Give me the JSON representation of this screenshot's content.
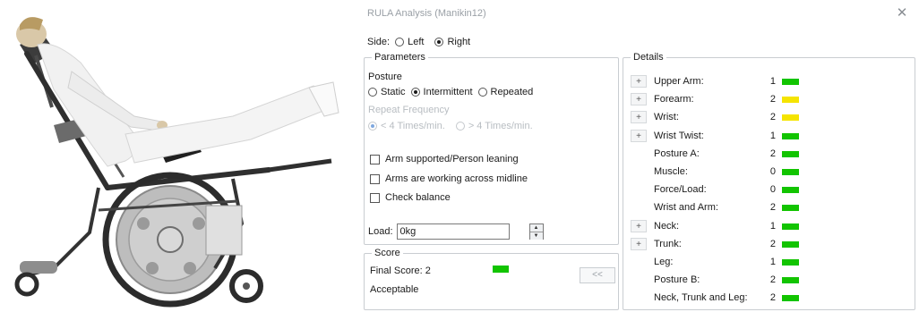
{
  "window": {
    "title": "RULA Analysis (Manikin12)",
    "close_icon": "close-icon"
  },
  "side": {
    "label": "Side:",
    "options": [
      {
        "label": "Left",
        "selected": false
      },
      {
        "label": "Right",
        "selected": true
      }
    ]
  },
  "parameters": {
    "legend": "Parameters",
    "posture_label": "Posture",
    "posture_options": [
      {
        "label": "Static",
        "selected": false
      },
      {
        "label": "Intermittent",
        "selected": true
      },
      {
        "label": "Repeated",
        "selected": false
      }
    ],
    "repeat_label": "Repeat Frequency",
    "repeat_options": [
      {
        "label": "< 4 Times/min.",
        "selected": true,
        "disabled": true
      },
      {
        "label": "> 4 Times/min.",
        "selected": false,
        "disabled": true
      }
    ],
    "checkboxes": [
      {
        "label": "Arm supported/Person leaning",
        "checked": false
      },
      {
        "label": "Arms are working across midline",
        "checked": false
      },
      {
        "label": "Check balance",
        "checked": false
      }
    ],
    "load_label": "Load:",
    "load_value": "0kg"
  },
  "score": {
    "legend": "Score",
    "final_label": "Final Score: 2",
    "status": "Acceptable",
    "collapse_label": "<<",
    "bar_color": "#12c400"
  },
  "details": {
    "legend": "Details",
    "expand_label": "+",
    "rows": [
      {
        "label": "Upper Arm:",
        "value": "1",
        "color": "#12c400",
        "expandable": true
      },
      {
        "label": "Forearm:",
        "value": "2",
        "color": "#f5e400",
        "expandable": true
      },
      {
        "label": "Wrist:",
        "value": "2",
        "color": "#f5e400",
        "expandable": true
      },
      {
        "label": "Wrist Twist:",
        "value": "1",
        "color": "#12c400",
        "expandable": true
      },
      {
        "label": "Posture A:",
        "value": "2",
        "color": "#12c400",
        "expandable": false
      },
      {
        "label": "Muscle:",
        "value": "0",
        "color": "#12c400",
        "expandable": false
      },
      {
        "label": "Force/Load:",
        "value": "0",
        "color": "#12c400",
        "expandable": false
      },
      {
        "label": "Wrist and Arm:",
        "value": "2",
        "color": "#12c400",
        "expandable": false
      },
      {
        "label": "Neck:",
        "value": "1",
        "color": "#12c400",
        "expandable": true
      },
      {
        "label": "Trunk:",
        "value": "2",
        "color": "#12c400",
        "expandable": true
      },
      {
        "label": "Leg:",
        "value": "1",
        "color": "#12c400",
        "expandable": false
      },
      {
        "label": "Posture B:",
        "value": "2",
        "color": "#12c400",
        "expandable": false
      },
      {
        "label": "Neck, Trunk and Leg:",
        "value": "2",
        "color": "#12c400",
        "expandable": false
      }
    ]
  }
}
